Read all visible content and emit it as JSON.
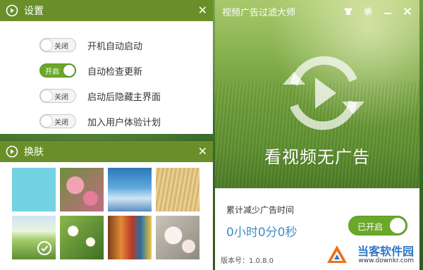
{
  "settings_panel": {
    "title": "设置",
    "close_symbol": "✕",
    "items": [
      {
        "label": "开机自动启动",
        "toggle_text": "关闭",
        "on": false
      },
      {
        "label": "自动检查更新",
        "toggle_text": "开启",
        "on": true
      },
      {
        "label": "启动后隐藏主界面",
        "toggle_text": "关闭",
        "on": false
      },
      {
        "label": "加入用户体验计划",
        "toggle_text": "关闭",
        "on": false
      }
    ]
  },
  "skin_panel": {
    "title": "换肤",
    "close_symbol": "✕",
    "skins": [
      {
        "name": "sky-blue"
      },
      {
        "name": "pink-flowers"
      },
      {
        "name": "blue-sky-clouds"
      },
      {
        "name": "wheat-field"
      },
      {
        "name": "green-meadow",
        "selected": true
      },
      {
        "name": "white-daisies"
      },
      {
        "name": "colored-pencils"
      },
      {
        "name": "blossom"
      }
    ]
  },
  "main_window": {
    "title": "视频广告过滤大师",
    "window_controls": [
      "shirt-icon",
      "gear-icon",
      "minimize-icon",
      "close-icon"
    ],
    "slogan": "看视频无广告",
    "stat_label": "累计减少广告时间",
    "stat_value": "0小时0分0秒",
    "main_toggle_text": "已开启",
    "version_label": "版本号：",
    "version_value": "1.0.8.0"
  },
  "watermark": {
    "main": "当客软件园",
    "sub": "www.downkr.com"
  },
  "colors": {
    "header_green": "#6a8f2a",
    "toggle_green": "#6aa82a",
    "stat_blue": "#3f8fbf",
    "watermark_blue": "#2f76c8"
  }
}
